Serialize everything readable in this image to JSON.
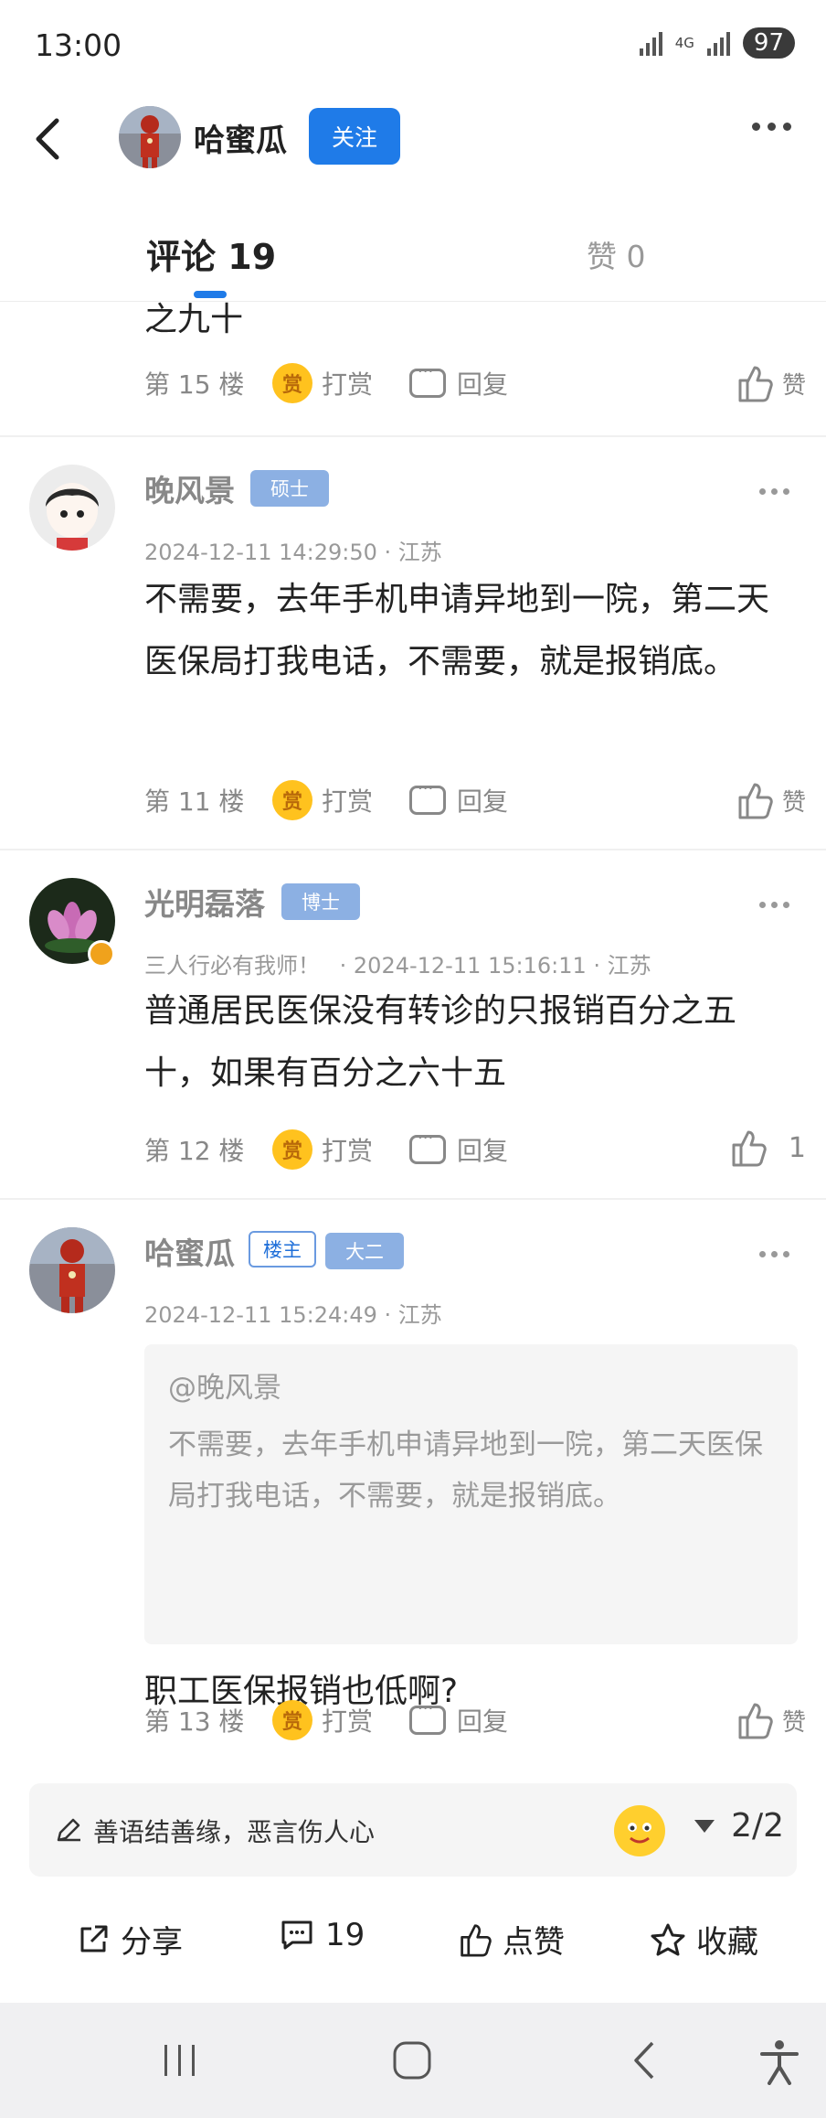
{
  "status_bar": {
    "time": "13:00",
    "network": "4G",
    "battery": "97"
  },
  "header": {
    "title": "哈蜜瓜",
    "follow_label": "关注"
  },
  "tabs": {
    "comments_label": "评论",
    "comments_count": "19",
    "likes_label": "赞",
    "likes_count": "0"
  },
  "partial_comment": {
    "text_tail": "之九十",
    "floor": "第 15 楼",
    "reward_label": "打赏",
    "reply_label": "回复",
    "like_label": "赞"
  },
  "comments": [
    {
      "user": "晚风景",
      "badge": "硕士",
      "subtitle": "",
      "timestamp": "2024-12-11 14:29:50 · 江苏",
      "text": "不需要，去年手机申请异地到一院，第二天医保局打我电话，不需要，就是报销底。",
      "floor": "第 11 楼",
      "reward_label": "打赏",
      "reply_label": "回复",
      "like": "赞"
    },
    {
      "user": "光明磊落",
      "badge": "博士",
      "subtitle": "三人行必有我师！",
      "timestamp": "· 2024-12-11 15:16:11 · 江苏",
      "text": "普通居民医保没有转诊的只报销百分之五十，如果有百分之六十五",
      "floor": "第 12 楼",
      "reward_label": "打赏",
      "reply_label": "回复",
      "like": "1"
    },
    {
      "user": "哈蜜瓜",
      "owner_badge": "楼主",
      "badge": "大二",
      "timestamp": "2024-12-11 15:24:49 · 江苏",
      "quote_mention": "@晚风景",
      "quote_text": "不需要，去年手机申请异地到一院，第二天医保局打我电话，不需要，就是报销底。",
      "text": "职工医保报销也低啊?",
      "floor": "第 13 楼",
      "reward_label": "打赏",
      "reply_label": "回复",
      "like": "赞"
    }
  ],
  "reward_icon_char": "赏",
  "input_bar": {
    "placeholder": "善语结善缘，恶言伤人心",
    "page_indicator": "2/2"
  },
  "toolbar": {
    "share": "分享",
    "comments": "19",
    "like": "点赞",
    "favorite": "收藏"
  },
  "colors": {
    "accent": "#1f7be8",
    "reward": "#ffc21e",
    "badge": "#8cb0e3"
  },
  "icons": [
    "back-icon",
    "more-icon",
    "reward-icon",
    "reply-icon",
    "thumb-up-icon",
    "pen-icon",
    "emoji-icon",
    "share-icon",
    "comment-icon",
    "star-icon",
    "nav-recents-icon",
    "nav-home-icon",
    "nav-back-icon",
    "accessibility-icon"
  ]
}
